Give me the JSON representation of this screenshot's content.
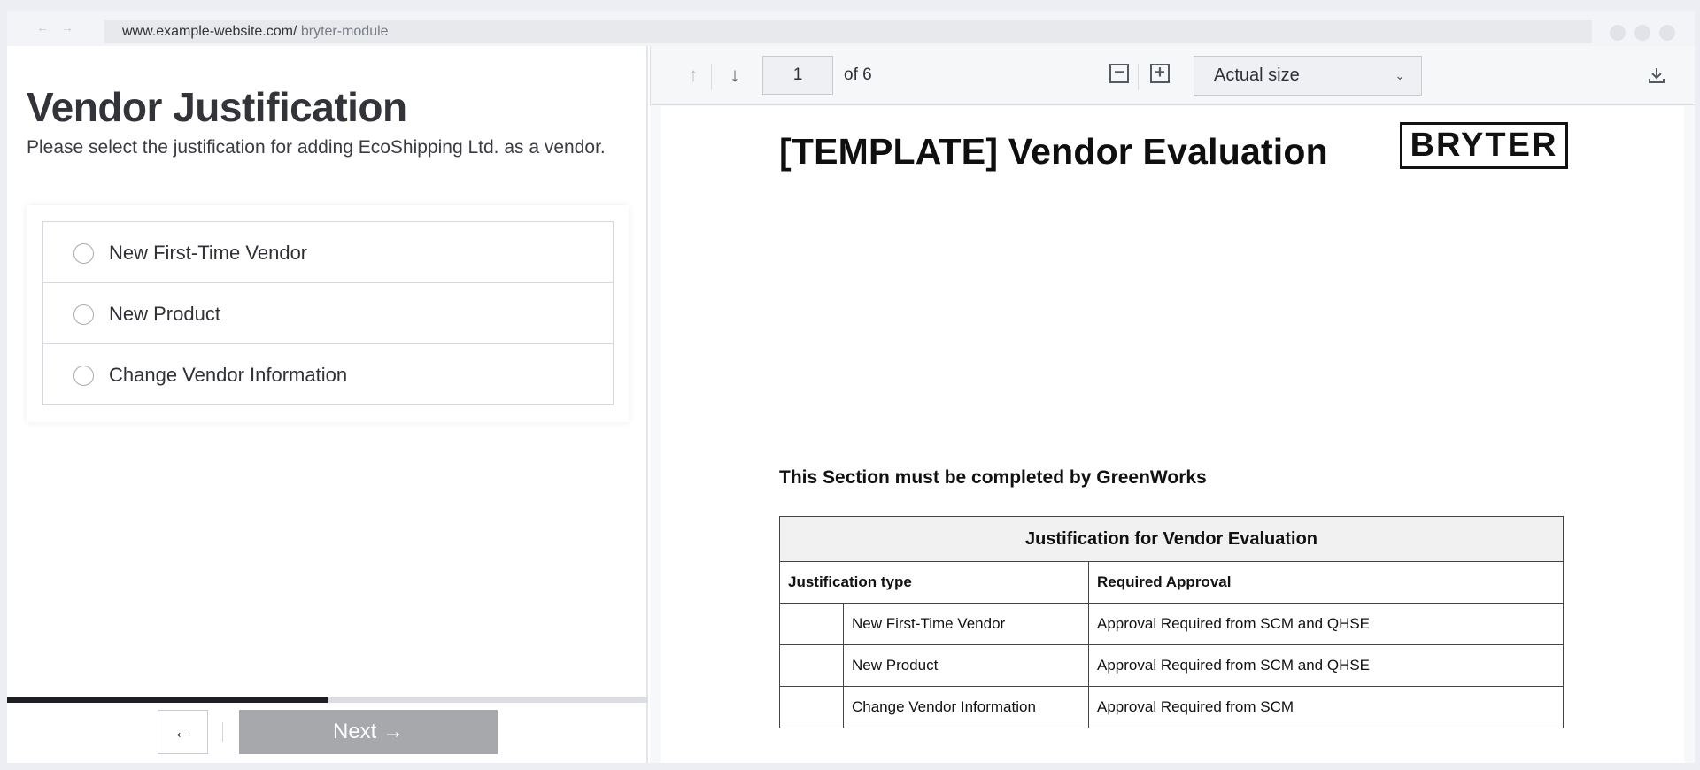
{
  "browser": {
    "url_domain": "www.example-website.com/",
    "url_path": " bryter-module"
  },
  "form": {
    "title": "Vendor Justification",
    "subtitle": "Please select the justification for adding EcoShipping Ltd. as a vendor.",
    "options": [
      {
        "label": "New First-Time Vendor"
      },
      {
        "label": "New Product"
      },
      {
        "label": "Change Vendor Information"
      }
    ],
    "progress_fraction": 0.5,
    "back_glyph": "←",
    "next_label": "Next →"
  },
  "viewer": {
    "page_current": "1",
    "page_total_text": "of 6",
    "zoom": "Actual size",
    "icons": [
      "arrow-up-icon",
      "arrow-down-icon",
      "zoom-out-icon",
      "zoom-in-icon",
      "chevron-down-icon",
      "download-icon"
    ]
  },
  "document": {
    "title": "[TEMPLATE] Vendor Evaluation",
    "logo_text": "BRYTER",
    "section_note": "This Section must be completed by GreenWorks",
    "table": {
      "caption": "Justification for Vendor Evaluation",
      "headers": [
        "Justification type",
        "Required Approval"
      ],
      "rows": [
        {
          "type": "New First-Time Vendor",
          "approval": "Approval Required from SCM and QHSE"
        },
        {
          "type": "New Product",
          "approval": "Approval Required from SCM and QHSE"
        },
        {
          "type": "Change Vendor Information",
          "approval": "Approval Required from SCM"
        }
      ]
    }
  }
}
